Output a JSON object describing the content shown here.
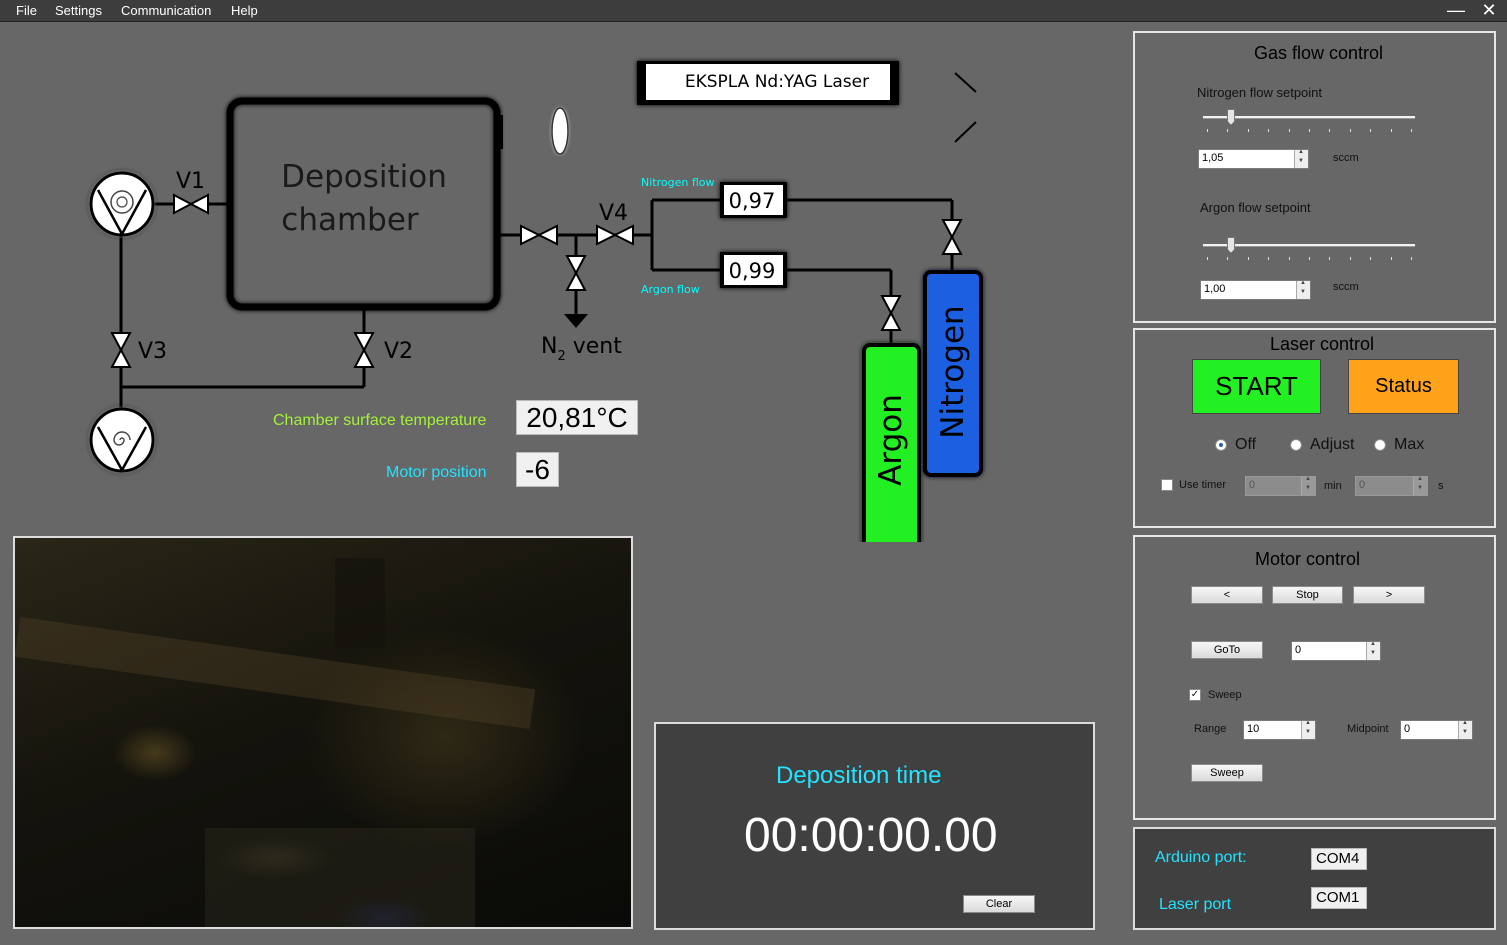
{
  "menu": [
    "File",
    "Settings",
    "Communication",
    "Help"
  ],
  "window": {
    "minimize": "—",
    "close": "✕"
  },
  "diagram": {
    "laser_label": "EKSPLA Nd:YAG Laser",
    "chamber_line1": "Deposition",
    "chamber_line2": "chamber",
    "valves": {
      "v1": "V1",
      "v2": "V2",
      "v3": "V3",
      "v4": "V4"
    },
    "vent_label": "N",
    "vent_sub": "2",
    "vent_suffix": " vent",
    "nitrogen_flow_label": "Nitrogen flow",
    "argon_flow_label": "Argon flow",
    "nitrogen_flow_value": "0,97",
    "argon_flow_value": "0,99",
    "argon_bottle": "Argon",
    "nitrogen_bottle": "Nitrogen"
  },
  "chamber_temp": {
    "label": "Chamber surface temperature",
    "value": "20,81°C"
  },
  "motor_position": {
    "label": "Motor position",
    "value": "-6"
  },
  "deposition": {
    "title": "Deposition time",
    "time": "00:00:00.00",
    "clear": "Clear"
  },
  "gas_flow": {
    "title": "Gas flow control",
    "nitrogen_label": "Nitrogen flow setpoint",
    "nitrogen_value": "1,05",
    "nitrogen_unit": "sccm",
    "nitrogen_fraction": 0.12,
    "argon_label": "Argon flow setpoint",
    "argon_value": "1,00",
    "argon_unit": "sccm",
    "argon_fraction": 0.12
  },
  "laser_control": {
    "title": "Laser control",
    "start": "START",
    "status": "Status",
    "modes": [
      "Off",
      "Adjust",
      "Max"
    ],
    "selected_mode": "Off",
    "use_timer": "Use timer",
    "min_value": "0",
    "min_unit": "min",
    "sec_value": "0",
    "sec_unit": "s",
    "colors": {
      "start": "#22f022",
      "status": "#ffa31a"
    }
  },
  "motor_control": {
    "title": "Motor control",
    "left": "<",
    "stop": "Stop",
    "right": ">",
    "goto": "GoTo",
    "goto_value": "0",
    "sweep_check": "Sweep",
    "sweep_checked": true,
    "range_label": "Range",
    "range_value": "10",
    "midpoint_label": "Midpoint",
    "midpoint_value": "0",
    "sweep_button": "Sweep"
  },
  "ports": {
    "arduino_label": "Arduino port:",
    "arduino_value": "COM4",
    "laser_label": "Laser port",
    "laser_value": "COM1"
  }
}
